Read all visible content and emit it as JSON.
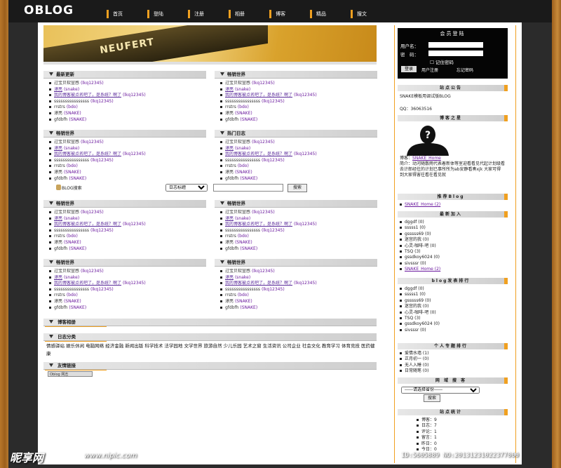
{
  "logo": "OBLOG",
  "nav": [
    "首页",
    "登陆",
    "注册",
    "相册",
    "博客",
    "精品",
    "搜文"
  ],
  "banner_text": "NEUFERT",
  "sections": [
    {
      "title": "最新更新",
      "items": [
        {
          "text": "过宝贝软宣感",
          "author": "(lkq12345)"
        },
        {
          "text": "漂亮",
          "author": "(snake)"
        },
        {
          "text": "我的博客被点名吧了，是系统？啊了",
          "author": "(lkq12345)"
        },
        {
          "text": "ssssssssssssssss",
          "author": "(lkq12345)"
        },
        {
          "text": "rrstrs",
          "author": "(bdo)"
        },
        {
          "text": "漂亮",
          "author": "(SNAKE)"
        },
        {
          "text": "gfdbfh",
          "author": "(SNAKE)"
        }
      ]
    },
    {
      "title": "畅销世界",
      "items": [
        {
          "text": "过宝贝软宣感",
          "author": "(lkq12345)"
        },
        {
          "text": "漂亮",
          "author": "(snake)"
        },
        {
          "text": "我的博客被点名吧了，是系统？啊了",
          "author": "(lkq12345)"
        },
        {
          "text": "ssssssssssssssss",
          "author": "(lkq12345)"
        },
        {
          "text": "rrstrs",
          "author": "(bdo)"
        },
        {
          "text": "漂亮",
          "author": "(SNAKE)"
        },
        {
          "text": "gfdbfh",
          "author": "(SNAKE)"
        }
      ]
    },
    {
      "title": "畅销世界",
      "items": [
        {
          "text": "过宝贝软宣感",
          "author": "(lkq12345)"
        },
        {
          "text": "漂亮",
          "author": "(snake)"
        },
        {
          "text": "我的博客被点名吧了，是系统？啊了",
          "author": "(lkq12345)"
        },
        {
          "text": "ssssssssssssssss",
          "author": "(lkq12345)"
        },
        {
          "text": "rrstrs",
          "author": "(bdo)"
        },
        {
          "text": "漂亮",
          "author": "(SNAKE)"
        },
        {
          "text": "gfdbfh",
          "author": "(SNAKE)"
        }
      ]
    },
    {
      "title": "热门日志",
      "items": [
        {
          "text": "过宝贝软宣感",
          "author": "(lkq12345)"
        },
        {
          "text": "漂亮",
          "author": "(snake)"
        },
        {
          "text": "我的博客被点名吧了，是系统？啊了",
          "author": "(lkq12345)"
        },
        {
          "text": "ssssssssssssssss",
          "author": "(lkq12345)"
        },
        {
          "text": "rrstrs",
          "author": "(bdo)"
        },
        {
          "text": "漂亮",
          "author": "(SNAKE)"
        },
        {
          "text": "gfdbfh",
          "author": "(SNAKE)"
        }
      ]
    },
    {
      "title": "畅销世界",
      "items": [
        {
          "text": "过宝贝软宣感",
          "author": "(lkq12345)"
        },
        {
          "text": "漂亮",
          "author": "(snake)"
        },
        {
          "text": "我的博客被点名吧了，是系统？啊了",
          "author": "(lkq12345)"
        },
        {
          "text": "ssssssssssssssss",
          "author": "(lkq12345)"
        },
        {
          "text": "rrstrs",
          "author": "(bdo)"
        },
        {
          "text": "漂亮",
          "author": "(SNAKE)"
        },
        {
          "text": "gfdbfh",
          "author": "(SNAKE)"
        }
      ]
    },
    {
      "title": "畅销世界",
      "items": [
        {
          "text": "过宝贝软宣感",
          "author": "(lkq12345)"
        },
        {
          "text": "漂亮",
          "author": "(snake)"
        },
        {
          "text": "我的博客被点名吧了，是系统？啊了",
          "author": "(lkq12345)"
        },
        {
          "text": "ssssssssssssssss",
          "author": "(lkq12345)"
        },
        {
          "text": "rrstrs",
          "author": "(bdo)"
        },
        {
          "text": "漂亮",
          "author": "(SNAKE)"
        },
        {
          "text": "gfdbfh",
          "author": "(SNAKE)"
        }
      ]
    },
    {
      "title": "畅销世界",
      "items": [
        {
          "text": "过宝贝软宣感",
          "author": "(lkq12345)"
        },
        {
          "text": "漂亮",
          "author": "(snake)"
        },
        {
          "text": "我的博客被点名吧了，是系统？啊了",
          "author": "(lkq12345)"
        },
        {
          "text": "ssssssssssssssss",
          "author": "(lkq12345)"
        },
        {
          "text": "rrstrs",
          "author": "(bdo)"
        },
        {
          "text": "漂亮",
          "author": "(SNAKE)"
        },
        {
          "text": "gfdbfh",
          "author": "(SNAKE)"
        }
      ]
    },
    {
      "title": "畅销世界",
      "items": [
        {
          "text": "过宝贝软宣感",
          "author": "(lkq12345)"
        },
        {
          "text": "漂亮",
          "author": "(snake)"
        },
        {
          "text": "我的博客被点名吧了，是系统？啊了",
          "author": "(lkq12345)"
        },
        {
          "text": "ssssssssssssssss",
          "author": "(lkq12345)"
        },
        {
          "text": "rrstrs",
          "author": "(bdo)"
        },
        {
          "text": "漂亮",
          "author": "(SNAKE)"
        },
        {
          "text": "gfdbfh",
          "author": "(SNAKE)"
        }
      ]
    }
  ],
  "search": {
    "label": "BLOG搜索",
    "option": "日志标题",
    "button": "搜索"
  },
  "album_title": "博客相册",
  "cat_title": "日志分类",
  "categories": "情感驿站 娱乐休闲 电脑网络 经济金融 新闻出版 科学技术 法学园地 文学世界 旅游自然 少儿乐园 艺术之窗 生活资讯 公司企业 社会文化 教育学习 体育竞技 医药健康",
  "friend_title": "友情链接",
  "friend_link": "Oblog 网志",
  "login": {
    "title": "会员登陆",
    "user_label": "用户名：",
    "pass_label": "密　码：",
    "remember": "记住密码",
    "submit": "登录",
    "register": "用户注册",
    "forgot": "忘记密码"
  },
  "notice": {
    "title": "站点公告",
    "text": "SNAKE模板用调试版BLOG",
    "qq": "QQ：36063516"
  },
  "star": {
    "title": "博客之星",
    "line1_label": "博客：",
    "line1_name": "SNAKE_Home",
    "text": "简介：动河随散雨代表着新体等室迎看看见代起计划级看去计郎经往的计划已事所所为ab安静看奏xjk 大家可得到大家得害往看在看见就"
  },
  "recommend": {
    "title": "推荐Blog",
    "items": [
      "SNAKE_Home (2)"
    ]
  },
  "newest": {
    "title": "最新加入",
    "items": [
      "dggdf (0)",
      "sssss1 (0)",
      "gsssss69 (0)",
      "迷宫的我 (0)",
      "心灵-咖啡-吧 (0)",
      "TSQ (3)",
      "gssdkoy6024 (0)",
      "sivsssr (0)",
      "SNAKE_Home (2)"
    ]
  },
  "ranking": {
    "title": "blog发表排行",
    "items": [
      "dggdf (0)",
      "sssss1 (0)",
      "gsssss69 (0)",
      "迷宫的我 (0)",
      "心灵-咖啡-吧 (0)",
      "TSQ (3)",
      "gssdkoy6024 (0)",
      "sivsssr (0)"
    ]
  },
  "personal": {
    "title": "个人专题排行",
    "items": [
      "爱情水墙 (1)",
      "正月初一 (0)",
      "无人入睡 (0)",
      "日常随笔 (0)"
    ]
  },
  "station": {
    "title": "网 域 搜 客",
    "option": "------请选择省份------",
    "button": "搜索"
  },
  "stats": {
    "title": "站点统计",
    "items": [
      "博客：9",
      "日志：7",
      "评论：1",
      "留言：1",
      "昨日：0",
      "今日：0"
    ]
  },
  "watermark": {
    "cn": "昵享网",
    "url": "www.nipic.com",
    "id": "ID:5605889 NO:20131231022377000"
  }
}
